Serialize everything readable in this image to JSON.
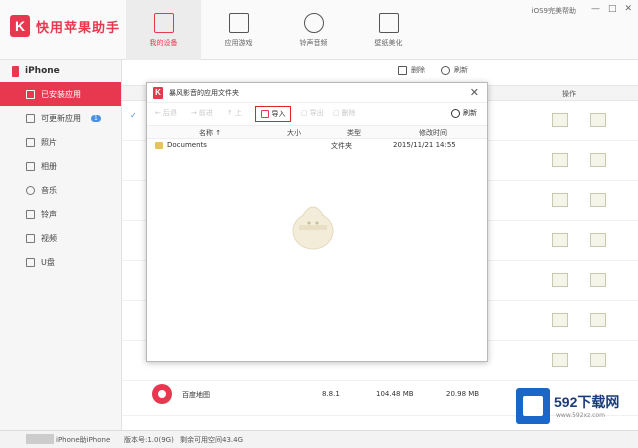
{
  "app": {
    "name": "快用苹果助手",
    "logo_letter": "K",
    "help_text": "iOS9完美帮助",
    "window_buttons": [
      "—",
      "□",
      "✕"
    ]
  },
  "nav": {
    "items": [
      {
        "label": "我的设备",
        "icon": "device-icon",
        "active": true
      },
      {
        "label": "应用游戏",
        "icon": "apps-icon",
        "active": false
      },
      {
        "label": "铃声音频",
        "icon": "music-icon",
        "active": false
      },
      {
        "label": "壁纸美化",
        "icon": "wallpaper-icon",
        "active": false
      }
    ]
  },
  "sidebar": {
    "device": "iPhone",
    "items": [
      {
        "label": "已安装应用",
        "icon": "installed-apps-icon",
        "active": true
      },
      {
        "label": "可更新应用",
        "icon": "update-apps-icon",
        "badge": "1"
      },
      {
        "label": "照片",
        "icon": "photo-icon"
      },
      {
        "label": "相册",
        "icon": "album-icon"
      },
      {
        "label": "音乐",
        "icon": "music-icon"
      },
      {
        "label": "铃声",
        "icon": "ringtone-icon"
      },
      {
        "label": "视频",
        "icon": "video-icon"
      },
      {
        "label": "U盘",
        "icon": "usb-icon"
      }
    ]
  },
  "main": {
    "toolbar": {
      "delete_label": "删除",
      "refresh_label": "刷新"
    },
    "column_operation": "操作",
    "app_row": {
      "name": "百度地图",
      "version": "8.8.1",
      "size": "104.48 MB",
      "doc_size": "20.98 MB"
    }
  },
  "dialog": {
    "title": "暴风影音的应用文件夹",
    "toolbar": {
      "back": "后退",
      "forward": "前进",
      "up": "上",
      "import": "导入",
      "export": "导出",
      "delete": "删除",
      "refresh": "刷新"
    },
    "columns": {
      "name": "名称 ↑",
      "size": "大小",
      "type": "类型",
      "modified": "修改时间"
    },
    "files": [
      {
        "name": "Documents",
        "type": "文件夹",
        "modified": "2015/11/21 14:55"
      }
    ]
  },
  "statusbar": {
    "device": "iPhone助iPhone",
    "version": "版本号:1.0(9G)",
    "capacity": "剩余可用空间43.4G"
  },
  "watermark": {
    "text": "592下载网",
    "url": "www.592xz.com"
  },
  "colors": {
    "accent": "#e8384f",
    "import_border": "#d9262c",
    "watermark_blue": "#1a67c9"
  }
}
